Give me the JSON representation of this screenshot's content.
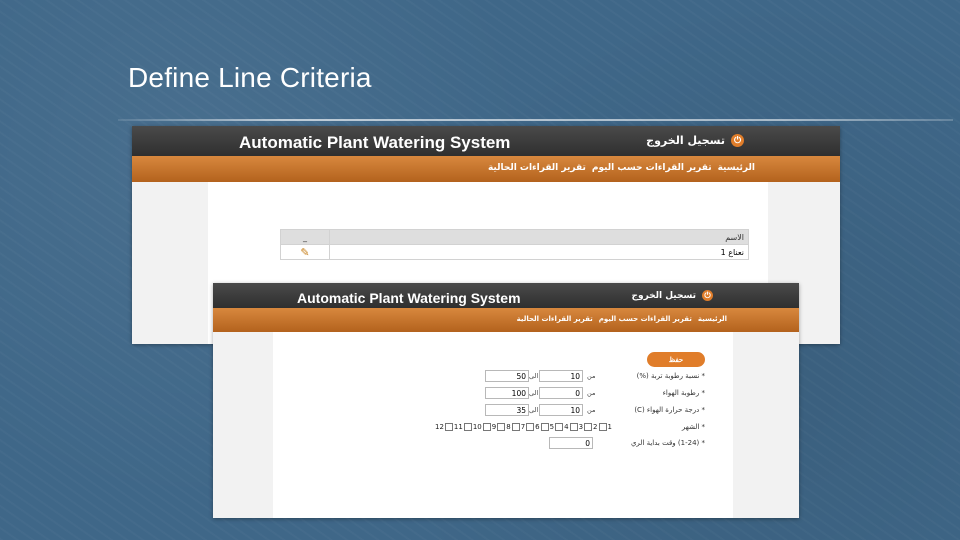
{
  "slide": {
    "title": "Define Line Criteria"
  },
  "app1": {
    "title": "Automatic Plant Watering System",
    "logout": "تسجيل الخروج",
    "nav": [
      "الرئيسية",
      "تقرير القراءات حسب اليوم",
      "تقرير القراءات الحالية"
    ],
    "table": {
      "header": "الاسم",
      "header_action": "_",
      "rows": [
        {
          "name": "نعناع 1"
        }
      ]
    }
  },
  "app2": {
    "title": "Automatic Plant Watering System",
    "logout": "تسجيل الخروج",
    "nav": [
      "الرئيسية",
      "تقرير القراءات حسب اليوم",
      "تقرير القراءات الحالية"
    ],
    "save_label": "حفظ",
    "from_label": "من",
    "to_label": "الى",
    "fields": {
      "soil": {
        "label": "* نسبة رطوبة تربة (%)",
        "from": "10",
        "to": "50"
      },
      "air": {
        "label": "* رطوبة الهواء",
        "from": "0",
        "to": "100"
      },
      "temp": {
        "label": "* درجة حرارة الهواء (C)",
        "from": "10",
        "to": "35"
      },
      "month": {
        "label": "* الشهر"
      },
      "start": {
        "label": "* (1-24) وقت بداية الري",
        "value": "0"
      }
    },
    "months": [
      "1",
      "2",
      "3",
      "4",
      "5",
      "6",
      "7",
      "8",
      "9",
      "10",
      "11",
      "12"
    ]
  }
}
